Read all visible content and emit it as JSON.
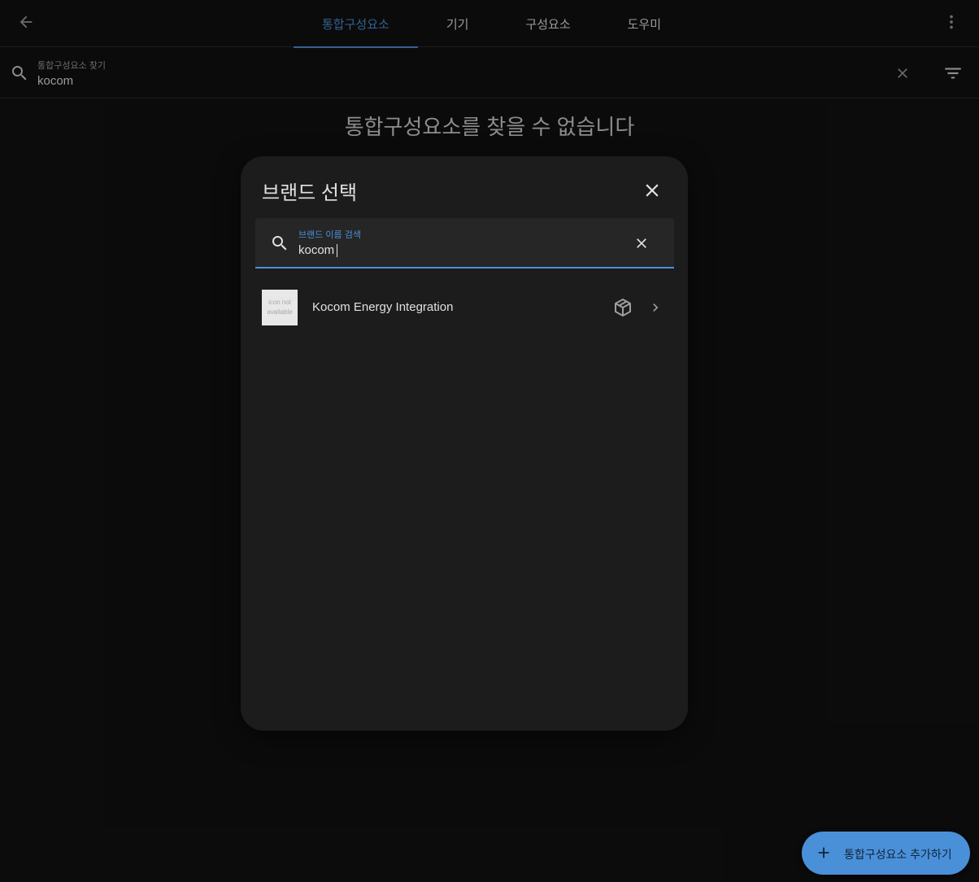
{
  "topbar": {
    "tabs": [
      {
        "label": "통합구성요소",
        "active": true
      },
      {
        "label": "기기",
        "active": false
      },
      {
        "label": "구성요소",
        "active": false
      },
      {
        "label": "도우미",
        "active": false
      }
    ]
  },
  "search": {
    "label": "통합구성요소 찾기",
    "value": "kocom"
  },
  "empty": {
    "title": "통합구성요소를 찾을 수 없습니다",
    "subtitle": ""
  },
  "dialog": {
    "title": "브랜드 선택",
    "search": {
      "label": "브랜드 이름 검색",
      "value": "kocom"
    },
    "results": [
      {
        "thumb_text": "icon not available",
        "name": "Kocom Energy Integration",
        "icons": [
          "custom-integration-icon",
          "chevron-right-icon"
        ]
      }
    ]
  },
  "fab": {
    "label": "통합구성요소 추가하기"
  },
  "colors": {
    "accent": "#4a90d9",
    "background": "#111111",
    "dialog": "#1c1c1c"
  }
}
